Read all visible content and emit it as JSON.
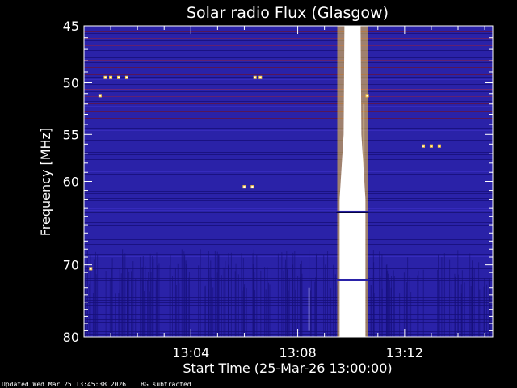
{
  "chart_data": {
    "type": "heatmap",
    "title": "Solar radio Flux (Glasgow)",
    "xlabel": "Start Time (25-Mar-26 13:00:00)",
    "ylabel": "Frequency [MHz]",
    "x_unit": "minutes after 13:00:00",
    "xlim": [
      0,
      15.3
    ],
    "ylim": [
      45,
      80
    ],
    "y_scale": "log",
    "y_ticks": [
      45,
      50,
      55,
      60,
      70,
      80
    ],
    "y_tick_labels": [
      "45",
      "50",
      "55",
      "60",
      "70",
      "80"
    ],
    "x_ticks": [
      4,
      8,
      12
    ],
    "x_tick_labels": [
      "13:04",
      "13:08",
      "13:12"
    ],
    "colors": {
      "background": "#000000",
      "base": "#2a22a8",
      "dark_band": "#160f78",
      "hot": "#ffffff",
      "warm": "#ffd040",
      "red": "#c8200a"
    },
    "features": {
      "strong_emission_minutes": [
        9.6,
        10.5
      ],
      "gap_frequencies": [
        63.5,
        72.0
      ],
      "spots": [
        {
          "t": 0.8,
          "f": 49.5
        },
        {
          "t": 1.0,
          "f": 49.5
        },
        {
          "t": 1.3,
          "f": 49.5
        },
        {
          "t": 1.6,
          "f": 49.5
        },
        {
          "t": 0.6,
          "f": 51.2
        },
        {
          "t": 6.4,
          "f": 49.5
        },
        {
          "t": 6.6,
          "f": 49.5
        },
        {
          "t": 12.7,
          "f": 56.2
        },
        {
          "t": 13.0,
          "f": 56.2
        },
        {
          "t": 13.3,
          "f": 56.2
        },
        {
          "t": 6.0,
          "f": 60.6
        },
        {
          "t": 6.3,
          "f": 60.6
        },
        {
          "t": 10.6,
          "f": 51.2
        },
        {
          "t": 0.25,
          "f": 70.5
        }
      ]
    }
  },
  "footer": {
    "updated": "Updated Wed Mar 25 13:45:38 2026",
    "note": "BG subtracted"
  }
}
